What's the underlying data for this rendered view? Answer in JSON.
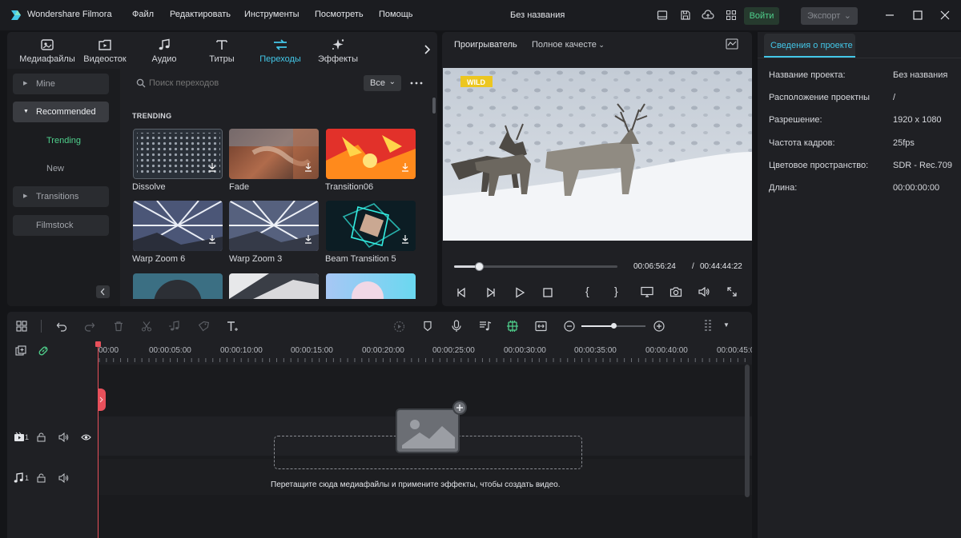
{
  "app": {
    "title": "Wondershare Filmora",
    "project_title": "Без названия",
    "login_label": "Войти",
    "export_label": "Экспорт"
  },
  "menu": [
    "Файл",
    "Редактировать",
    "Инструменты",
    "Посмотреть",
    "Помощь"
  ],
  "media_tabs": [
    {
      "label": "Медиафайлы",
      "icon": "media-icon"
    },
    {
      "label": "Видеосток",
      "icon": "stock-icon"
    },
    {
      "label": "Аудио",
      "icon": "music-icon"
    },
    {
      "label": "Титры",
      "icon": "text-icon"
    },
    {
      "label": "Переходы",
      "icon": "transition-icon",
      "active": true
    },
    {
      "label": "Эффекты",
      "icon": "effects-icon"
    }
  ],
  "sidebar": {
    "items": [
      {
        "label": "Mine",
        "state": "collapsed"
      },
      {
        "label": "Recommended",
        "state": "expanded"
      },
      {
        "label": "Trending",
        "state": "selected-sub"
      },
      {
        "label": "New",
        "state": "sub"
      },
      {
        "label": "Transitions",
        "state": "collapsed"
      },
      {
        "label": "Filmstock",
        "state": "plain"
      }
    ]
  },
  "search": {
    "placeholder": "Поиск переходов",
    "filter_value": "Все"
  },
  "section_title": "TRENDING",
  "transitions": [
    {
      "name": "Dissolve"
    },
    {
      "name": "Fade"
    },
    {
      "name": "Transition06"
    },
    {
      "name": "Warp Zoom 6"
    },
    {
      "name": "Warp Zoom 3"
    },
    {
      "name": "Beam Transition 5"
    }
  ],
  "player": {
    "tab_label": "Проигрыватель",
    "quality": "Полное качесте",
    "current_time": "00:06:56:24",
    "separator": "/",
    "total_time": "00:44:44:22",
    "progress": 0.15,
    "watermark": "WILD"
  },
  "project_info": {
    "tab_label": "Сведения о проекте",
    "rows": [
      {
        "label": "Название проекта:",
        "value": "Без названия"
      },
      {
        "label": "Расположение проектны",
        "value": "/"
      },
      {
        "label": "Разрешение:",
        "value": "1920 x 1080"
      },
      {
        "label": "Частота кадров:",
        "value": "25fps"
      },
      {
        "label": "Цветовое пространство:",
        "value": "SDR - Rec.709"
      },
      {
        "label": "Длина:",
        "value": "00:00:00:00"
      }
    ]
  },
  "timeline": {
    "ticks": [
      "00:00",
      "00:00:05:00",
      "00:00:10:00",
      "00:00:15:00",
      "00:00:20:00",
      "00:00:25:00",
      "00:00:30:00",
      "00:00:35:00",
      "00:00:40:00",
      "00:00:45:0"
    ],
    "drop_hint": "Перетащите сюда медиафайлы и примените эффекты, чтобы создать видео.",
    "video_track_label": "1",
    "audio_track_label": "1",
    "zoom_level": 0.5
  },
  "colors": {
    "accent": "#43c7e8",
    "green": "#4fd08c",
    "playhead": "#e8505b"
  }
}
